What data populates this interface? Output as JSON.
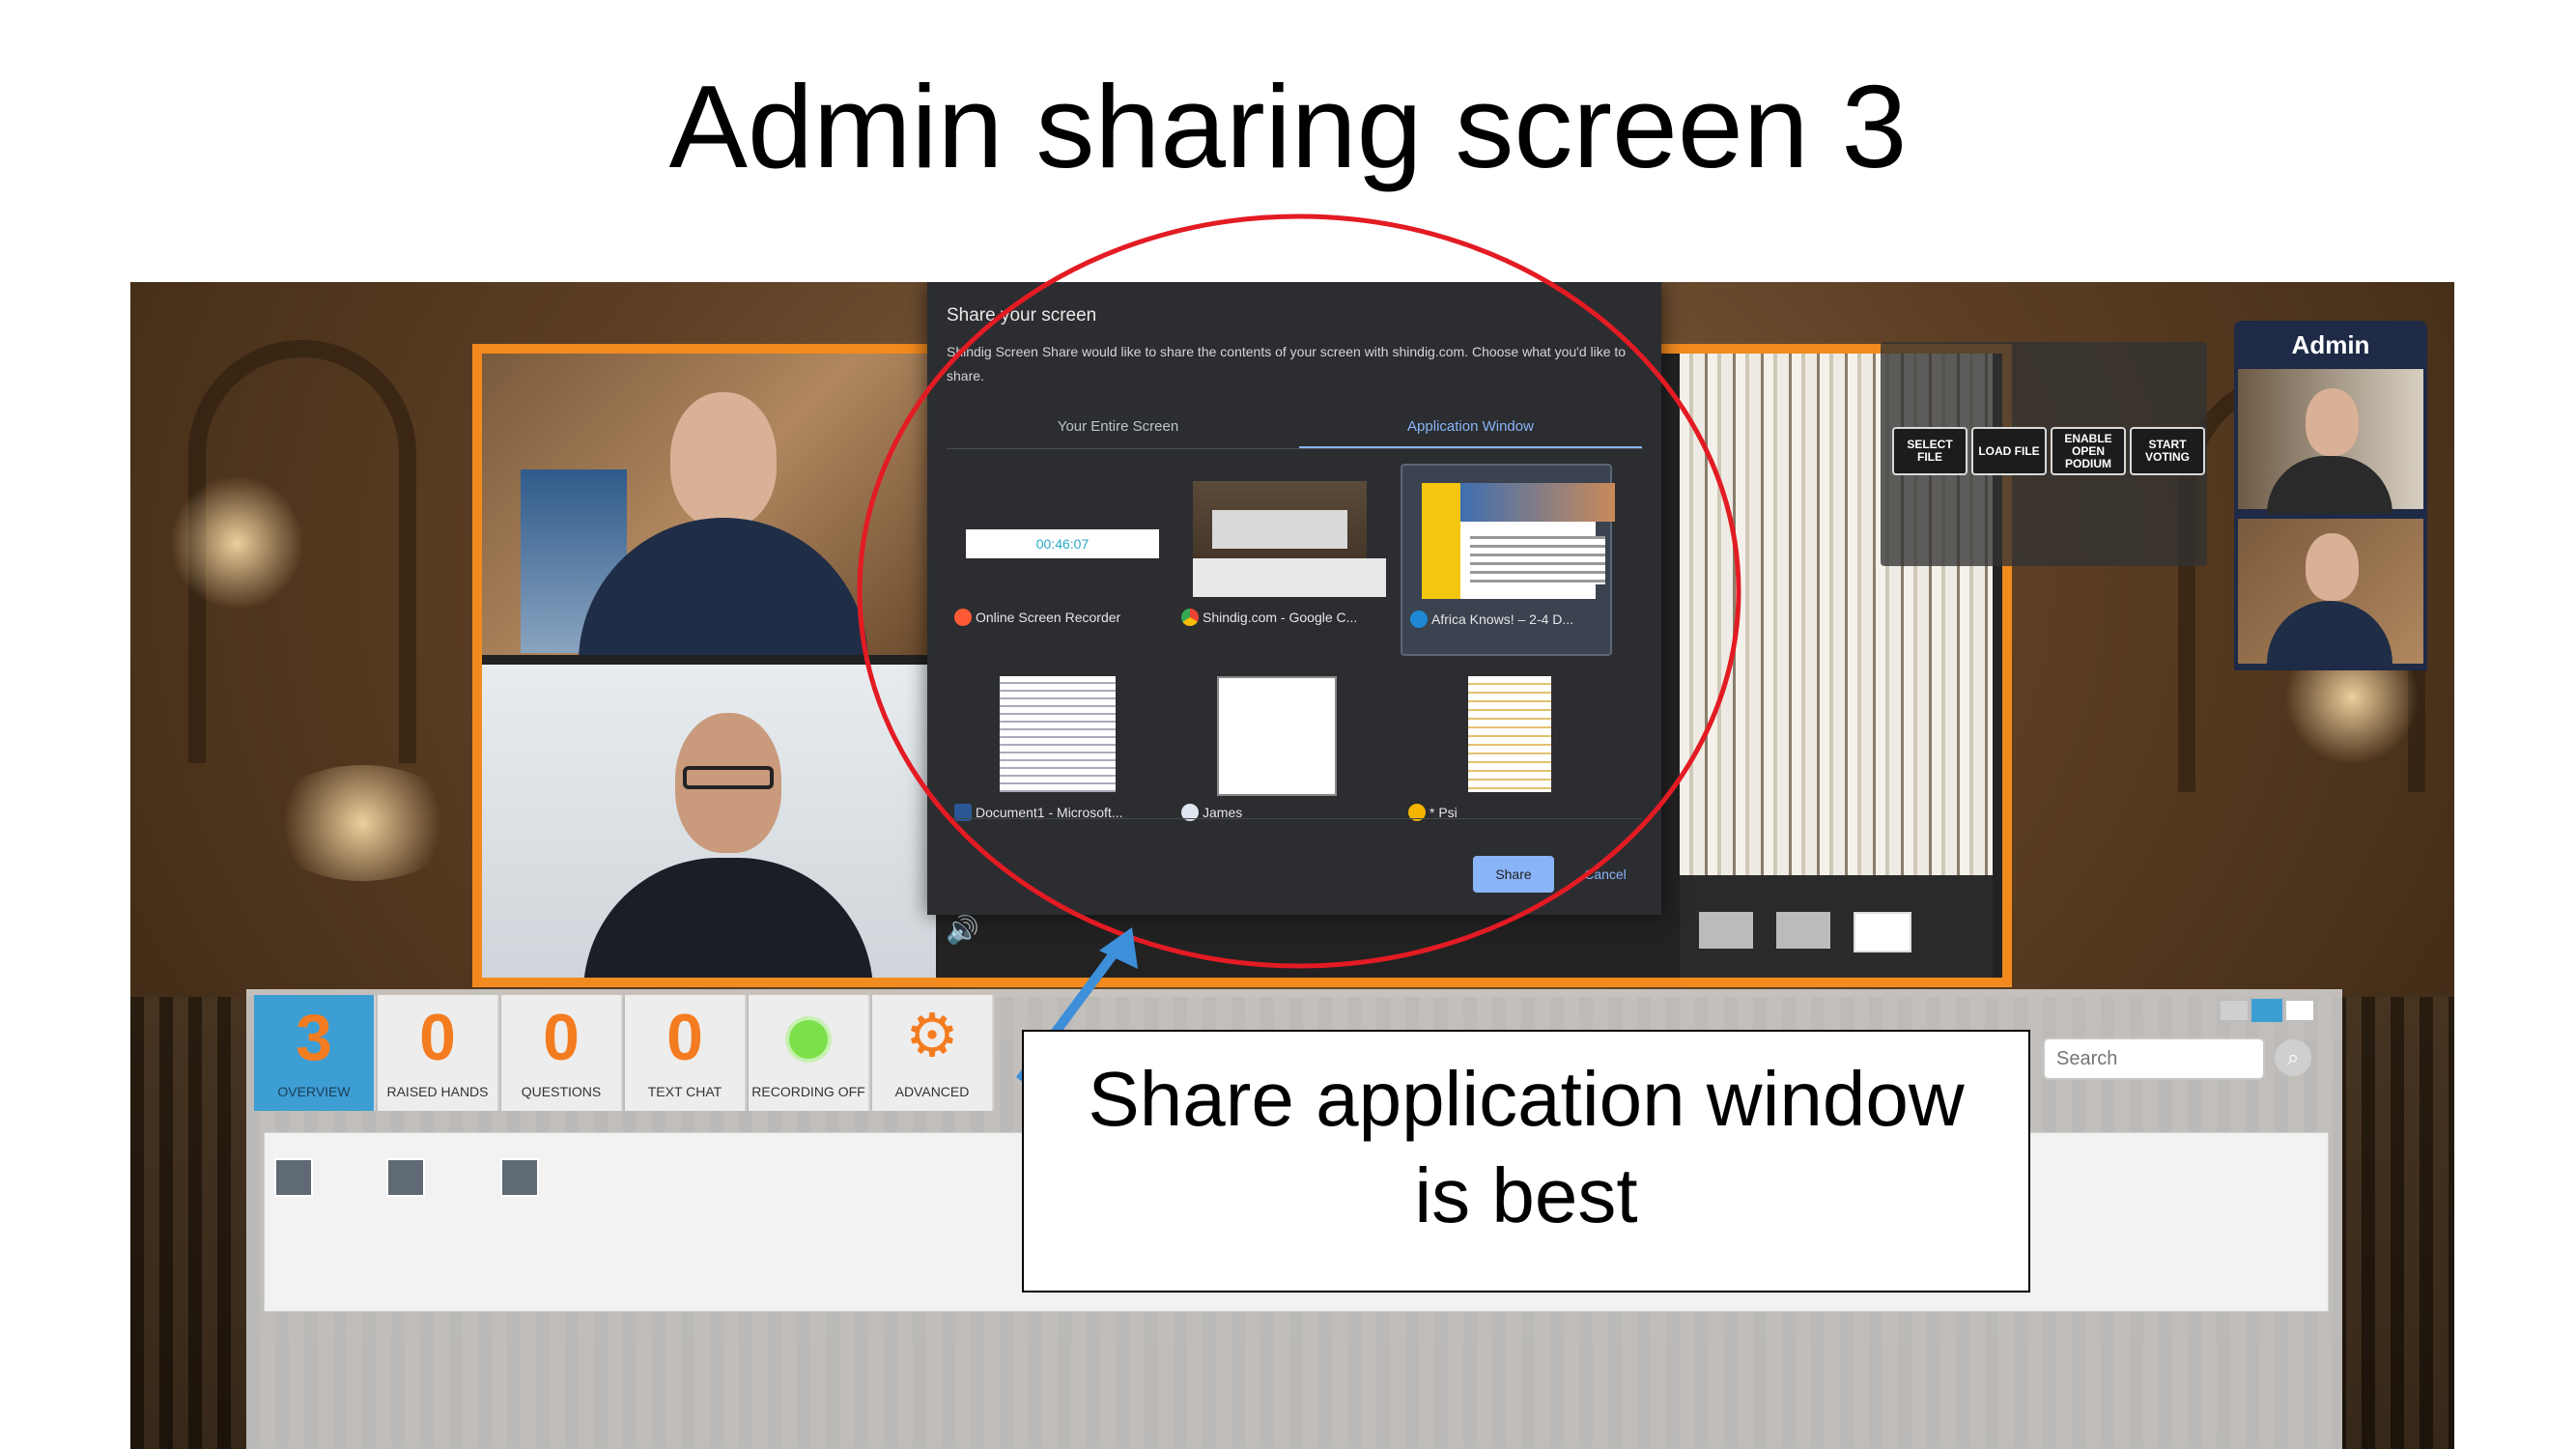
{
  "slide": {
    "title": "Admin sharing screen 3"
  },
  "dialog": {
    "title": "Share your screen",
    "description": "Shindig Screen Share would like to share the contents of your screen with shindig.com. Choose what you'd like to share.",
    "tabs": [
      {
        "label": "Your Entire Screen",
        "active": false
      },
      {
        "label": "Application Window",
        "active": true
      }
    ],
    "recorder_time": "00:46:07",
    "windows": [
      {
        "label": "Online Screen Recorder",
        "icon": "recorder-icon",
        "selected": false
      },
      {
        "label": "Shindig.com - Google C...",
        "icon": "chrome-icon",
        "selected": false
      },
      {
        "label": "Africa Knows! – 2-4 D...",
        "icon": "edge-icon",
        "selected": true
      },
      {
        "label": "Document1 - Microsoft...",
        "icon": "word-icon",
        "selected": false
      },
      {
        "label": "James",
        "icon": "chat-icon",
        "selected": false
      },
      {
        "label": "* Psi",
        "icon": "star-icon",
        "selected": false
      }
    ],
    "share_label": "Share",
    "cancel_label": "Cancel"
  },
  "controls": {
    "buttons": [
      "SELECT FILE",
      "LOAD FILE",
      "ENABLE OPEN PODIUM",
      "START VOTING"
    ]
  },
  "admin_panel": {
    "label": "Admin"
  },
  "toolbar": {
    "stats": [
      {
        "value": "3",
        "label": "OVERVIEW",
        "active": true
      },
      {
        "value": "0",
        "label": "RAISED HANDS",
        "active": false
      },
      {
        "value": "0",
        "label": "QUESTIONS",
        "active": false
      },
      {
        "value": "0",
        "label": "TEXT CHAT",
        "active": false
      }
    ],
    "recording_label": "RECORDING OFF",
    "advanced_label": "ADVANCED",
    "search_placeholder": "Search"
  },
  "callout": {
    "line1": "Share application window",
    "line2": "is best"
  },
  "colors": {
    "highlight_circle": "#e31b23",
    "arrow": "#3d8fd9",
    "frame_orange": "#f28a1e",
    "count_orange": "#f47c20"
  }
}
